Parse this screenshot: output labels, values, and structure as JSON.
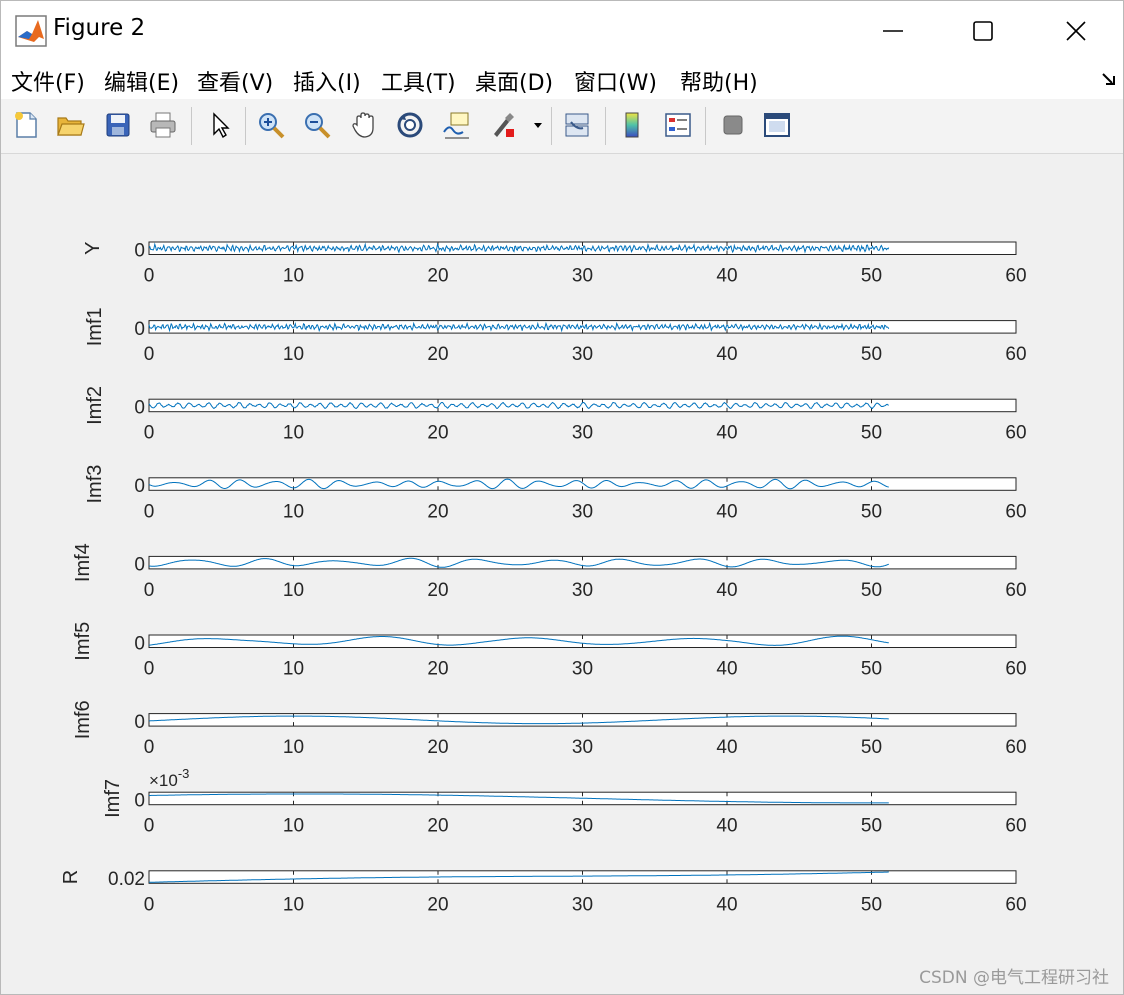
{
  "window": {
    "title": "Figure 2"
  },
  "menu": {
    "items": [
      "文件(F)",
      "编辑(E)",
      "查看(V)",
      "插入(I)",
      "工具(T)",
      "桌面(D)",
      "窗口(W)",
      "帮助(H)"
    ]
  },
  "toolbar": {
    "icons": [
      "new-figure-icon",
      "open-file-icon",
      "save-icon",
      "print-icon",
      "pointer-icon",
      "zoom-in-icon",
      "zoom-out-icon",
      "pan-icon",
      "rotate-3d-icon",
      "data-cursor-icon",
      "brush-icon",
      "brush-dropdown-icon",
      "link-plot-icon",
      "colorbar-icon",
      "legend-icon",
      "hide-plot-tools-icon",
      "show-plot-tools-icon"
    ]
  },
  "watermark": "CSDN @电气工程研习社",
  "chart_data": {
    "type": "line",
    "xlim": [
      0,
      60
    ],
    "xticks": [
      0,
      10,
      20,
      30,
      40,
      50,
      60
    ],
    "x_end": 51.2,
    "series_color": "#0072bd",
    "subplots": [
      {
        "ylabel": "Y",
        "ytick": "0"
      },
      {
        "ylabel": "Imf1",
        "ytick": "0"
      },
      {
        "ylabel": "Imf2",
        "ytick": "0"
      },
      {
        "ylabel": "Imf3",
        "ytick": "0"
      },
      {
        "ylabel": "Imf4",
        "ytick": "0"
      },
      {
        "ylabel": "Imf5",
        "ytick": "0"
      },
      {
        "ylabel": "Imf6",
        "ytick": "0"
      },
      {
        "ylabel": "Imf7",
        "ytick": "0",
        "exponent": "×10",
        "exponent_power": "-3"
      },
      {
        "ylabel": "R",
        "ytick": "0.02"
      }
    ]
  }
}
